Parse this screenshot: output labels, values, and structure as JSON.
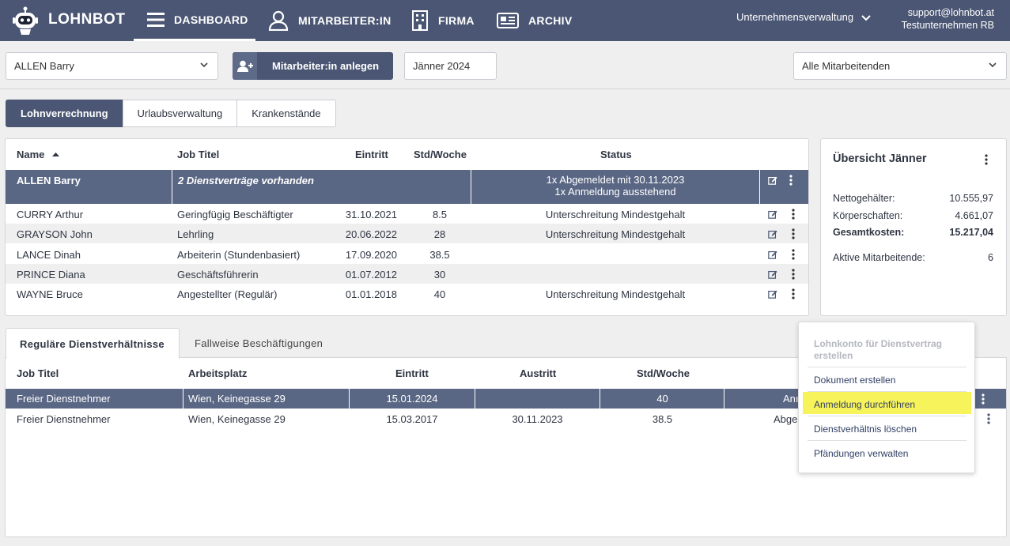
{
  "app": {
    "brand": "LOHNBOT"
  },
  "nav": {
    "dashboard": "DASHBOARD",
    "employees": "MITARBEITER:IN",
    "company": "FIRMA",
    "archive": "ARCHIV",
    "company_selector": "Unternehmensverwaltung",
    "account_email": "support@lohnbot.at",
    "account_company": "Testunternehmen RB"
  },
  "toolbar": {
    "employee_select": "ALLEN Barry",
    "create_button": "Mitarbeiter:in anlegen",
    "period": "Jänner 2024",
    "filter_select": "Alle Mitarbeitenden"
  },
  "tabs": [
    "Lohnverrechnung",
    "Urlaubsverwaltung",
    "Krankenstände"
  ],
  "employee_table": {
    "headers": {
      "name": "Name",
      "job": "Job Titel",
      "entry": "Eintritt",
      "hours": "Std/Woche",
      "status": "Status"
    },
    "selected": {
      "name": "ALLEN Barry",
      "job": "2 Dienstverträge vorhanden",
      "status_1": "1x Abgemeldet mit 30.11.2023",
      "status_2": "1x Anmeldung ausstehend"
    },
    "rows": [
      {
        "name": "CURRY Arthur",
        "job": "Geringfügig Beschäftigter",
        "entry": "31.10.2021",
        "hours": "8.5",
        "status": "Unterschreitung Mindestgehalt"
      },
      {
        "name": "GRAYSON John",
        "job": "Lehrling",
        "entry": "20.06.2022",
        "hours": "28",
        "status": "Unterschreitung Mindestgehalt"
      },
      {
        "name": "LANCE Dinah",
        "job": "Arbeiterin (Stundenbasiert)",
        "entry": "17.09.2020",
        "hours": "38.5",
        "status": ""
      },
      {
        "name": "PRINCE Diana",
        "job": "Geschäftsführerin",
        "entry": "01.07.2012",
        "hours": "30",
        "status": ""
      },
      {
        "name": "WAYNE Bruce",
        "job": "Angestellter (Regulär)",
        "entry": "01.01.2018",
        "hours": "40",
        "status": "Unterschreitung Mindestgehalt"
      }
    ]
  },
  "summary": {
    "title": "Übersicht Jänner",
    "net_label": "Nettogehälter:",
    "net_value": "10.555,97",
    "corp_label": "Körperschaften:",
    "corp_value": "4.661,07",
    "total_label": "Gesamtkosten:",
    "total_value": "15.217,04",
    "active_label": "Aktive Mitarbeitende:",
    "active_value": "6"
  },
  "contracts": {
    "tab_regular": "Reguläre Dienstverhältnisse",
    "tab_occasional": "Fallweise Beschäftigungen",
    "headers": {
      "job": "Job Titel",
      "workplace": "Arbeitsplatz",
      "entry": "Eintritt",
      "exit": "Austritt",
      "hours": "Std/Woche"
    },
    "rows": [
      {
        "job": "Freier Dienstnehmer",
        "workplace": "Wien, Keinegasse 29",
        "entry": "15.01.2024",
        "exit": "",
        "hours": "40",
        "status": "Anı"
      },
      {
        "job": "Freier Dienstnehmer",
        "workplace": "Wien, Keinegasse 29",
        "entry": "15.03.2017",
        "exit": "30.11.2023",
        "hours": "38.5",
        "status": "Abge"
      }
    ]
  },
  "context_menu": {
    "disabled_1": "Lohnkonto für Dienstvertrag",
    "disabled_2": "erstellen",
    "create_document": "Dokument erstellen",
    "register": "Anmeldung durchführen",
    "delete": "Dienstverhältnis löschen",
    "garnishment": "Pfändungen verwalten"
  },
  "colors": {
    "primary": "#4a5673",
    "highlight": "#f7f35a",
    "selected_row": "#5a6784"
  }
}
